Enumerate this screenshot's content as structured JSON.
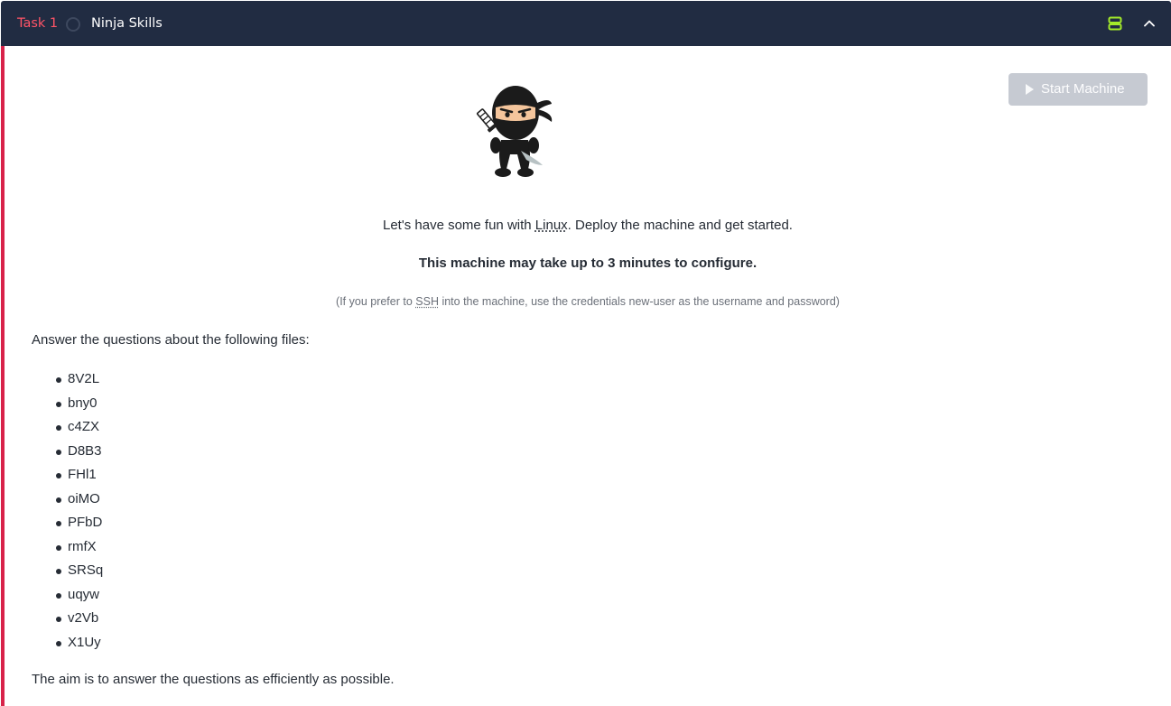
{
  "header": {
    "task_number": "Task 1",
    "title": "Ninja Skills",
    "icons": [
      "status-circle-icon",
      "server-icon",
      "chevron-up-icon"
    ]
  },
  "actions": {
    "start_machine_label": "Start Machine"
  },
  "content": {
    "intro_prefix": "Let's have some fun with ",
    "intro_link": "Linux",
    "intro_suffix": ". Deploy the machine and get started.",
    "config_note": "This machine may take up to 3 minutes to configure.",
    "ssh_prefix": "(If you prefer to ",
    "ssh_abbr": "SSH",
    "ssh_suffix": " into the machine, use the credentials new-user as the username and password)",
    "answer_intro": "Answer the questions about the following files:",
    "files": [
      "8V2L",
      "bny0",
      "c4ZX",
      "D8B3",
      "FHl1",
      "oiMO",
      "PFbD",
      "rmfX",
      "SRSq",
      "uqyw",
      "v2Vb",
      "X1Uy"
    ],
    "aim": "The aim is to answer the questions as efficiently as possible."
  },
  "colors": {
    "header_bg": "#212c42",
    "task_number": "#ff5467",
    "accent_border": "#d8234a",
    "server_icon": "#a3ea2a",
    "button_disabled": "#c6cad2"
  }
}
